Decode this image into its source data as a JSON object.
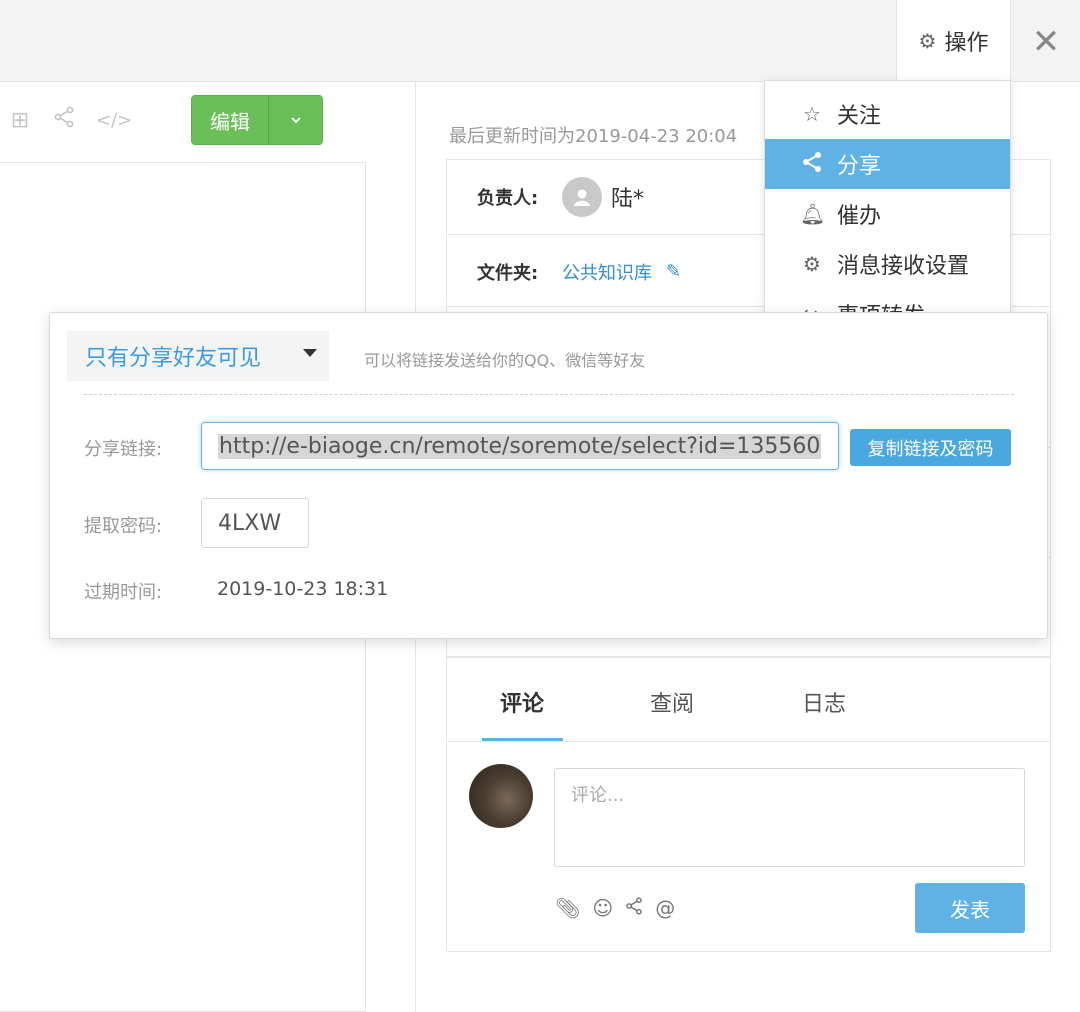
{
  "toolbar": {
    "ops_label": "操作",
    "close_glyph": "✕",
    "edit_label": "编辑"
  },
  "info": {
    "updated_text": "最后更新时间为2019-04-23 20:04",
    "owner_label": "负责人:",
    "owner_name": "陆*",
    "folder_label": "文件夹:",
    "folder_value": "公共知识库"
  },
  "ops_menu": {
    "items": [
      {
        "label": "关注",
        "icon": "star-icon"
      },
      {
        "label": "分享",
        "icon": "share-icon",
        "active": true
      },
      {
        "label": "催办",
        "icon": "bell-icon"
      },
      {
        "label": "消息接收设置",
        "icon": "gears-icon"
      },
      {
        "label": "事项转发",
        "icon": "forward-icon"
      }
    ]
  },
  "share": {
    "visibility": "只有分享好友可见",
    "hint": "可以将链接发送给你的QQ、微信等好友",
    "link_label": "分享链接:",
    "link_value": "http://e-biaoge.cn/remote/soremote/select?id=135560",
    "copy_label": "复制链接及密码",
    "pwd_label": "提取密码:",
    "pwd_value": "4LXW",
    "expire_label": "过期时间:",
    "expire_value": "2019-10-23 18:31"
  },
  "comments": {
    "tabs": [
      "评论",
      "查阅",
      "日志"
    ],
    "active_tab": 0,
    "placeholder": "评论...",
    "publish_label": "发表"
  },
  "colors": {
    "accent_blue": "#5fb2e3",
    "edit_green": "#6bbf59",
    "link_blue": "#3a9be0"
  }
}
